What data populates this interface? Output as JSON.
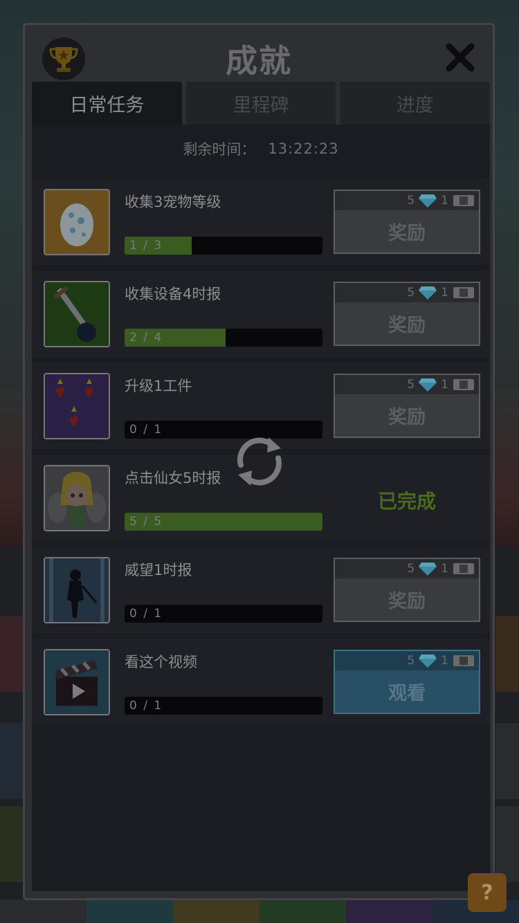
{
  "header": {
    "title": "成就"
  },
  "tabs": [
    {
      "label": "日常任务",
      "active": true
    },
    {
      "label": "里程碑",
      "active": false
    },
    {
      "label": "进度",
      "active": false
    }
  ],
  "timer": {
    "label": "剩余时间：",
    "value": "13:22:23"
  },
  "tasks": [
    {
      "label": "收集3宠物等级",
      "progress_text": "1 / 3",
      "progress": 0.333,
      "icon": "pet-egg-icon",
      "gems": "5",
      "tickets": "1",
      "action_label": "奖励"
    },
    {
      "label": "收集设备4时报",
      "progress_text": "2 / 4",
      "progress": 0.5,
      "icon": "sword-equipment-icon",
      "gems": "5",
      "tickets": "1",
      "action_label": "奖励"
    },
    {
      "label": "升级1工件",
      "progress_text": "0 / 1",
      "progress": 0.0,
      "icon": "artifact-hearts-icon",
      "gems": "5",
      "tickets": "1",
      "action_label": "奖励"
    },
    {
      "label": "点击仙女5时报",
      "progress_text": "5 / 5",
      "progress": 1.0,
      "icon": "fairy-icon",
      "status": "已完成"
    },
    {
      "label": "威望1时报",
      "progress_text": "0 / 1",
      "progress": 0.0,
      "icon": "prestige-silhouette-icon",
      "gems": "5",
      "tickets": "1",
      "action_label": "奖励"
    },
    {
      "label": "看这个视频",
      "progress_text": "0 / 1",
      "progress": 0.0,
      "icon": "video-clapper-icon",
      "gems": "5",
      "tickets": "1",
      "action_label": "观看"
    }
  ],
  "help": {
    "label": "?"
  },
  "colors": {
    "accent_done": "#4a6a1e",
    "progress_fill": "#3b5c20",
    "video_button": "#284f63",
    "gem": "#3f8aa3"
  }
}
